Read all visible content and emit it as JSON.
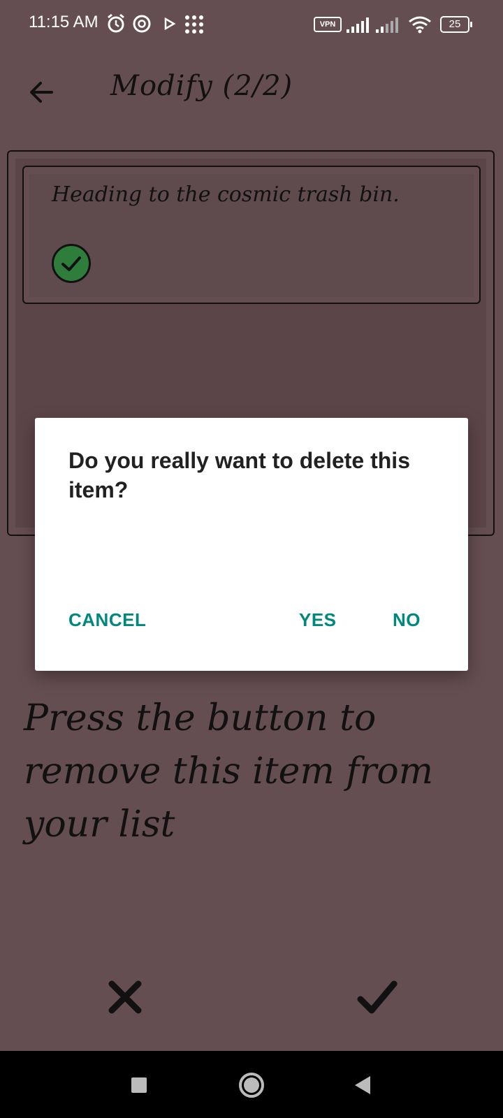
{
  "status_bar": {
    "time": "11:15 AM",
    "left_icons": [
      "alarm-icon",
      "chrome-icon",
      "play-icon",
      "grid-dots-icon"
    ],
    "vpn_label": "VPN",
    "battery_level": "25"
  },
  "header": {
    "back_icon": "arrow-left-icon",
    "title": "Modify (2/2)"
  },
  "item": {
    "text": "Heading to the cosmic trash bin.",
    "status_icon": "check-circle-icon",
    "status_color": "#2f7d3a"
  },
  "instruction": "Press the button to remove this item from your list",
  "actions": {
    "close_icon": "close-x-icon",
    "confirm_icon": "checkmark-icon"
  },
  "dialog": {
    "title": "Do you really want to delete this item?",
    "cancel_label": "CANCEL",
    "yes_label": "YES",
    "no_label": "NO",
    "accent_color": "#00897b"
  },
  "nav_bar": {
    "buttons": [
      "recents-square-icon",
      "home-circle-icon",
      "back-triangle-icon"
    ]
  }
}
